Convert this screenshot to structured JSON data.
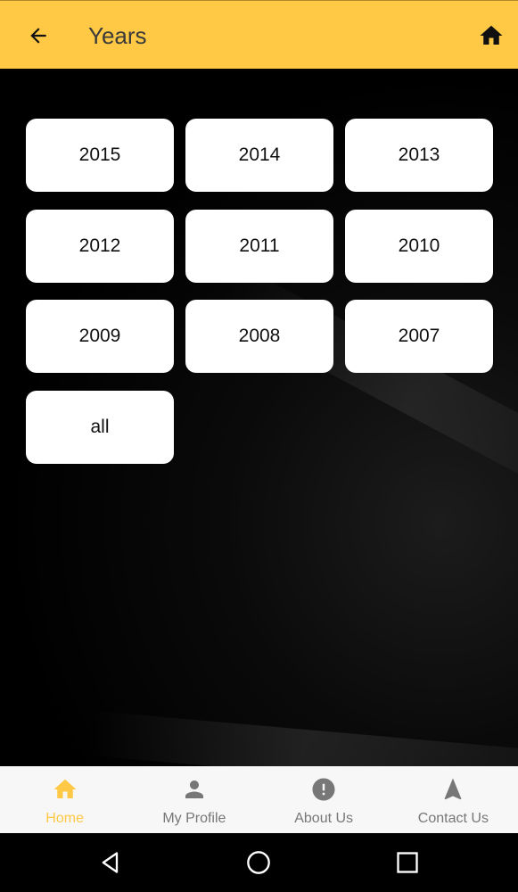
{
  "header": {
    "title": "Years",
    "back_icon": "arrow-back-icon",
    "home_icon": "home-icon",
    "background": "#FFC845"
  },
  "years": [
    {
      "label": "2015"
    },
    {
      "label": "2014"
    },
    {
      "label": "2013"
    },
    {
      "label": "2012"
    },
    {
      "label": "2011"
    },
    {
      "label": "2010"
    },
    {
      "label": "2009"
    },
    {
      "label": "2008"
    },
    {
      "label": "2007"
    },
    {
      "label": "all"
    }
  ],
  "bottom_nav": {
    "items": [
      {
        "label": "Home",
        "icon": "home-icon",
        "active": true
      },
      {
        "label": "My Profile",
        "icon": "person-icon",
        "active": false
      },
      {
        "label": "About Us",
        "icon": "info-icon",
        "active": false
      },
      {
        "label": "Contact Us",
        "icon": "navigation-icon",
        "active": false
      }
    ],
    "active_color": "#FFC845",
    "inactive_color": "#777777"
  },
  "system_nav": {
    "back": "back-triangle-icon",
    "home": "home-circle-icon",
    "recents": "recents-square-icon"
  }
}
